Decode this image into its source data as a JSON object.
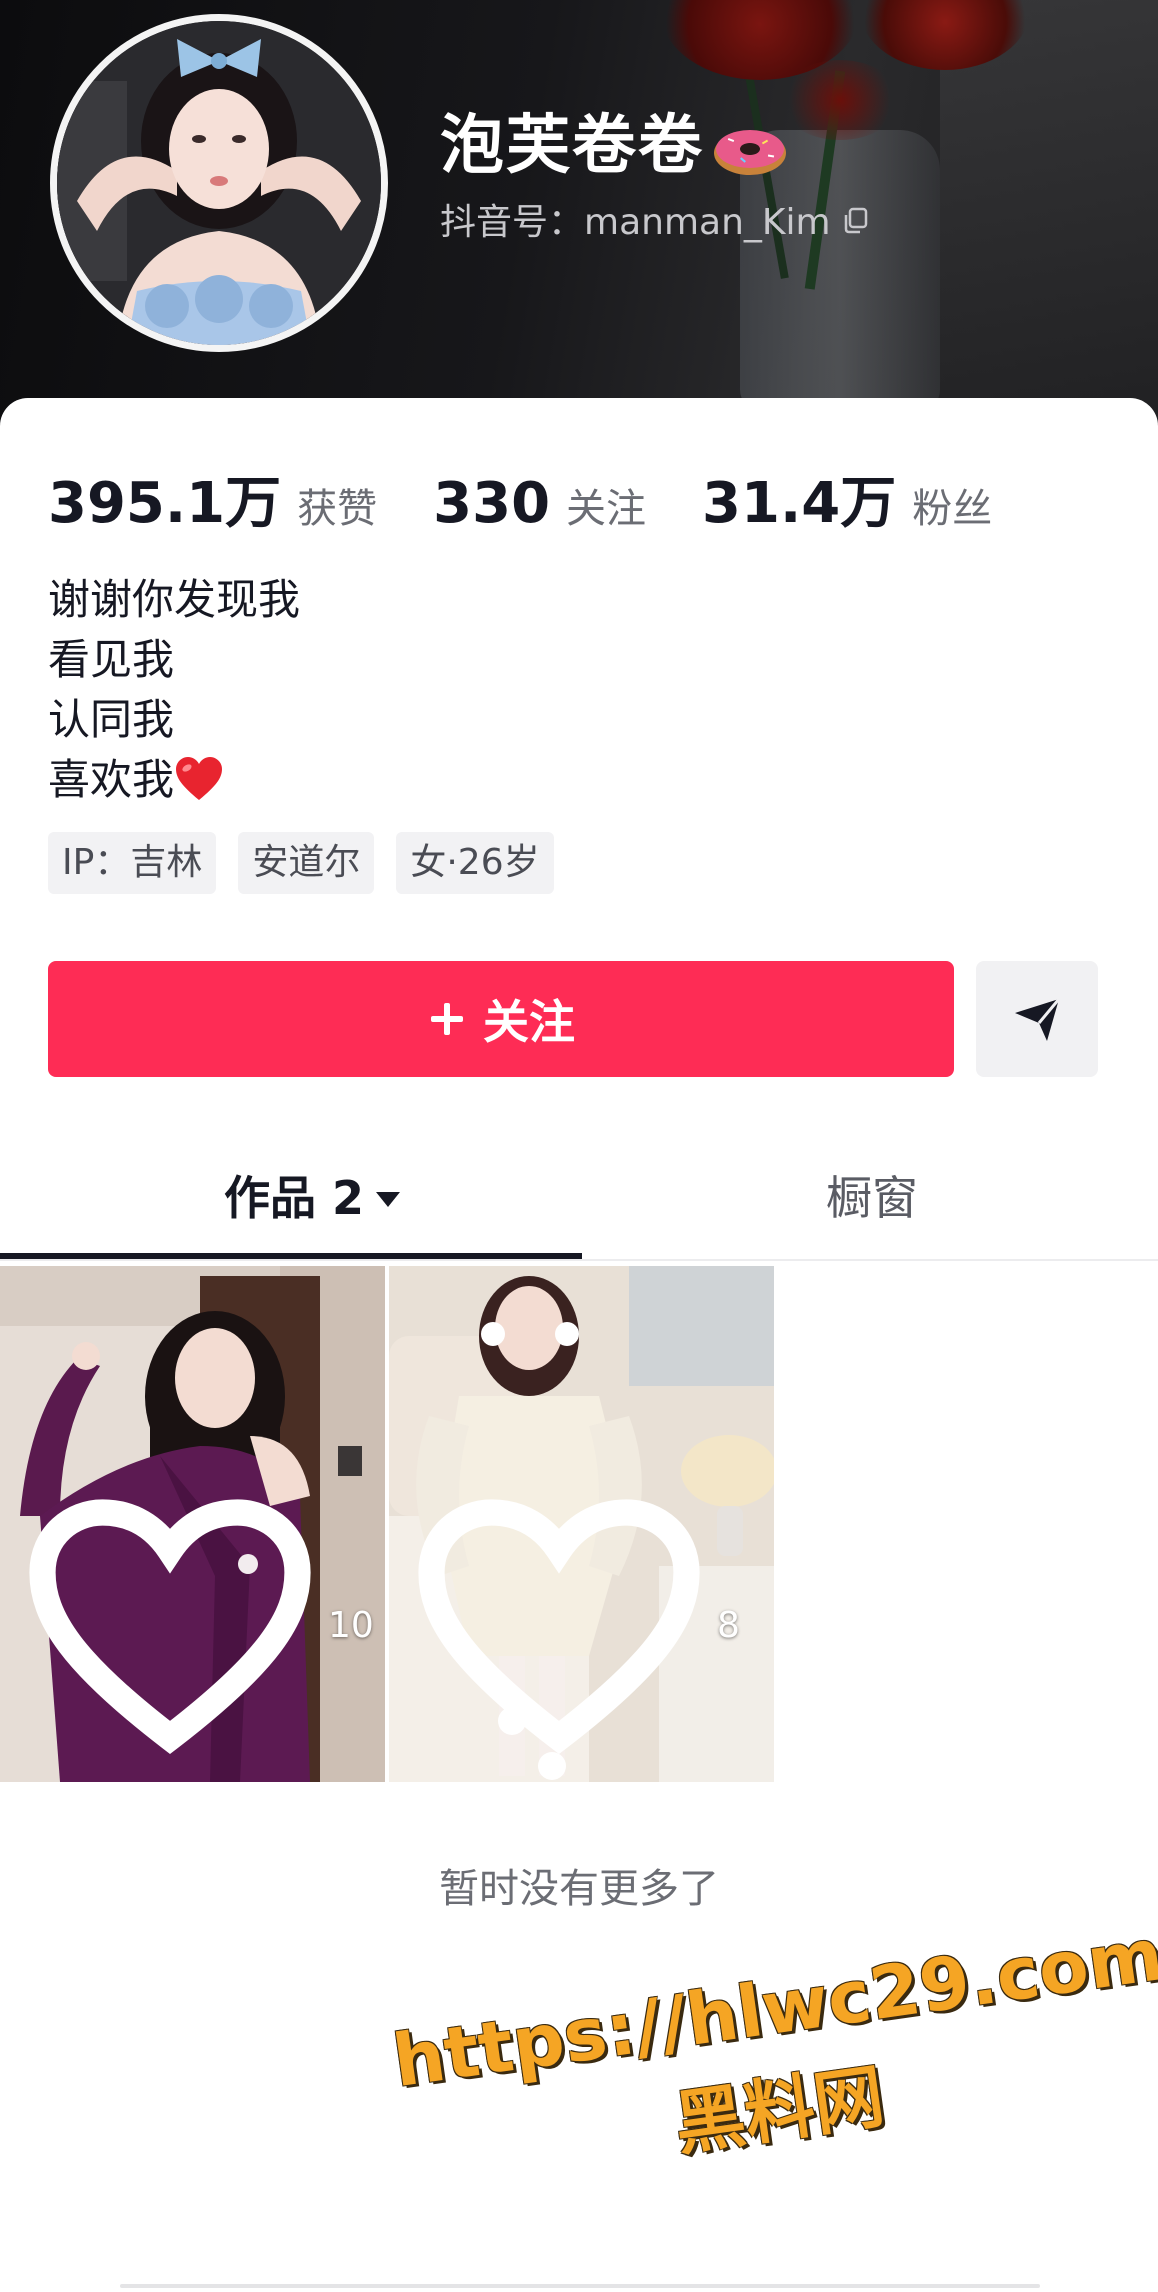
{
  "profile": {
    "nickname": "泡芙卷卷",
    "douyin_id": "抖音号：manman_Kim"
  },
  "stats": [
    {
      "value": "395.1万",
      "label": "获赞"
    },
    {
      "value": "330",
      "label": "关注"
    },
    {
      "value": "31.4万",
      "label": "粉丝"
    }
  ],
  "bio": {
    "lines": [
      "谢谢你发现我",
      "看见我",
      "认同我",
      "喜欢我"
    ]
  },
  "tags": [
    "IP：吉林",
    "安道尔",
    "女·26岁"
  ],
  "actions": {
    "follow_label": "关注"
  },
  "tabs": {
    "works_label": "作品 2",
    "showcase_label": "橱窗"
  },
  "videos": [
    {
      "likes": "10"
    },
    {
      "likes": "8"
    }
  ],
  "footer": {
    "no_more": "暂时没有更多了"
  },
  "watermark": {
    "url": "https://hlwc29.com",
    "site": "黑料网"
  },
  "colors": {
    "accent": "#fe2c55",
    "watermark": "#f5a524"
  }
}
